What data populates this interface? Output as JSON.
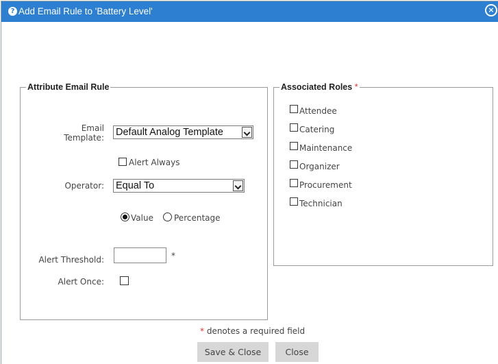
{
  "dialog": {
    "title": "Add Email Rule to 'Battery Level'",
    "help_icon_glyph": "?",
    "close_icon_glyph": "×"
  },
  "attribute_rule": {
    "legend": "Attribute Email Rule",
    "email_template_label_line1": "Email",
    "email_template_label_line2": "Template:",
    "email_template_value": "Default Analog Template",
    "alert_always_label": "Alert Always",
    "alert_always_checked": false,
    "operator_label": "Operator:",
    "operator_value": "Equal To",
    "radio_value_label": "Value",
    "radio_percentage_label": "Percentage",
    "selected_mode": "Value",
    "alert_threshold_label": "Alert Threshold:",
    "alert_threshold_value": "",
    "alert_once_label": "Alert Once:",
    "alert_once_checked": false,
    "required_marker": "*"
  },
  "roles": {
    "legend": "Associated Roles",
    "required_marker": "*",
    "items": [
      {
        "label": "Attendee",
        "checked": false
      },
      {
        "label": "Catering",
        "checked": false
      },
      {
        "label": "Maintenance",
        "checked": false
      },
      {
        "label": "Organizer",
        "checked": false
      },
      {
        "label": "Procurement",
        "checked": false
      },
      {
        "label": "Technician",
        "checked": false
      }
    ]
  },
  "footer": {
    "required_marker": "*",
    "required_note": "denotes a required field",
    "save_close_label": "Save & Close",
    "close_label": "Close"
  },
  "colors": {
    "titlebar": "#2d7fd1",
    "required": "#e03030",
    "button_bg": "#d7d7d7"
  }
}
